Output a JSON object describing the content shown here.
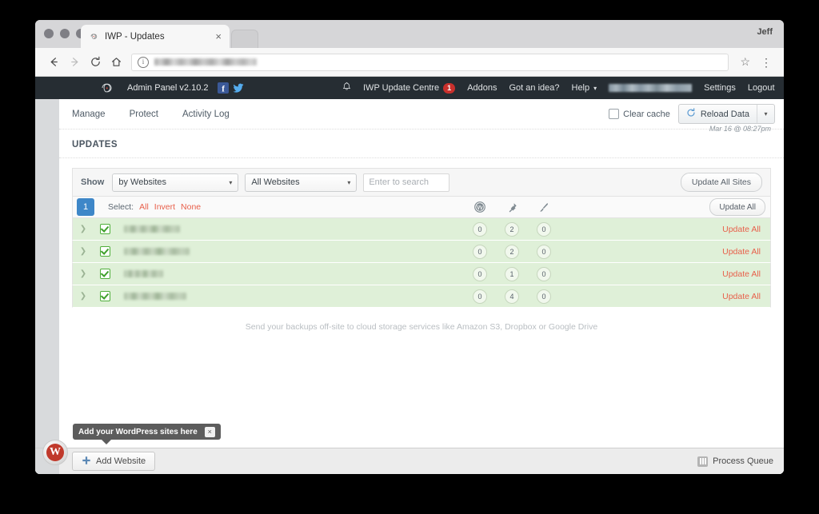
{
  "browser": {
    "profile_name": "Jeff",
    "tab": {
      "title": "IWP - Updates",
      "favicon": "infinity-favicon",
      "close": "×"
    },
    "toolbar": {
      "back": "←",
      "forward": "→",
      "reload": "⟳",
      "home": "⌂",
      "site_info_icon": "i",
      "url_value": "",
      "bookmark": "☆",
      "menu": "⋮"
    }
  },
  "appbar": {
    "brand": "Admin Panel v2.10.2",
    "social": [
      {
        "name": "facebook",
        "glyph": "f"
      },
      {
        "name": "twitter",
        "glyph": "ᴠ"
      }
    ],
    "bell": "🔔",
    "update_centre": {
      "label": "IWP Update Centre",
      "count": "1"
    },
    "addons": "Addons",
    "idea": "Got an idea?",
    "help": "Help",
    "help_caret": "▾",
    "settings": "Settings",
    "logout": "Logout"
  },
  "subnav": {
    "items": [
      {
        "label": "Manage"
      },
      {
        "label": "Protect"
      },
      {
        "label": "Activity Log"
      }
    ],
    "clear_cache": "Clear cache",
    "reload_data": "Reload Data",
    "reload_caret": "▾",
    "timestamp": "Mar 16 @ 08:27pm"
  },
  "page": {
    "title": "UPDATES"
  },
  "filters": {
    "show_label": "Show",
    "group_by": "by Websites",
    "scope": "All Websites",
    "search_placeholder": "Enter to search",
    "search_value": "",
    "update_all_sites": "Update All Sites"
  },
  "table": {
    "page_number": "1",
    "select_label": "Select:",
    "select_all": "All",
    "select_invert": "Invert",
    "select_none": "None",
    "columns": [
      {
        "name": "wordpress-icon",
        "title": "WordPress"
      },
      {
        "name": "plugin-icon",
        "title": "Plugins"
      },
      {
        "name": "theme-icon",
        "title": "Themes"
      }
    ],
    "update_all": "Update All",
    "rows": [
      {
        "site": "",
        "redact_width": 70,
        "core": "0",
        "plugins": "2",
        "themes": "0",
        "action": "Update All"
      },
      {
        "site": "",
        "redact_width": 82,
        "core": "0",
        "plugins": "2",
        "themes": "0",
        "action": "Update All"
      },
      {
        "site": "",
        "redact_width": 49,
        "core": "0",
        "plugins": "1",
        "themes": "0",
        "action": "Update All"
      },
      {
        "site": "",
        "redact_width": 78,
        "core": "0",
        "plugins": "4",
        "themes": "0",
        "action": "Update All"
      }
    ]
  },
  "promo": {
    "text": "Send your backups off-site to cloud storage services like Amazon S3, Dropbox or Google Drive"
  },
  "dock": {
    "add_website": "Add Website",
    "plus": "＋",
    "process_queue": "Process Queue",
    "tooltip": {
      "text": "Add your WordPress sites here",
      "close": "×"
    },
    "wp_glyph": "W"
  },
  "colors": {
    "appbar_bg": "#262d33",
    "row_green": "#dff0d8",
    "accent_red": "#e8604b",
    "badge_red": "#c9302c",
    "page_blue": "#3e87c8",
    "facebook": "#3b5998",
    "twitter": "#55acee"
  }
}
